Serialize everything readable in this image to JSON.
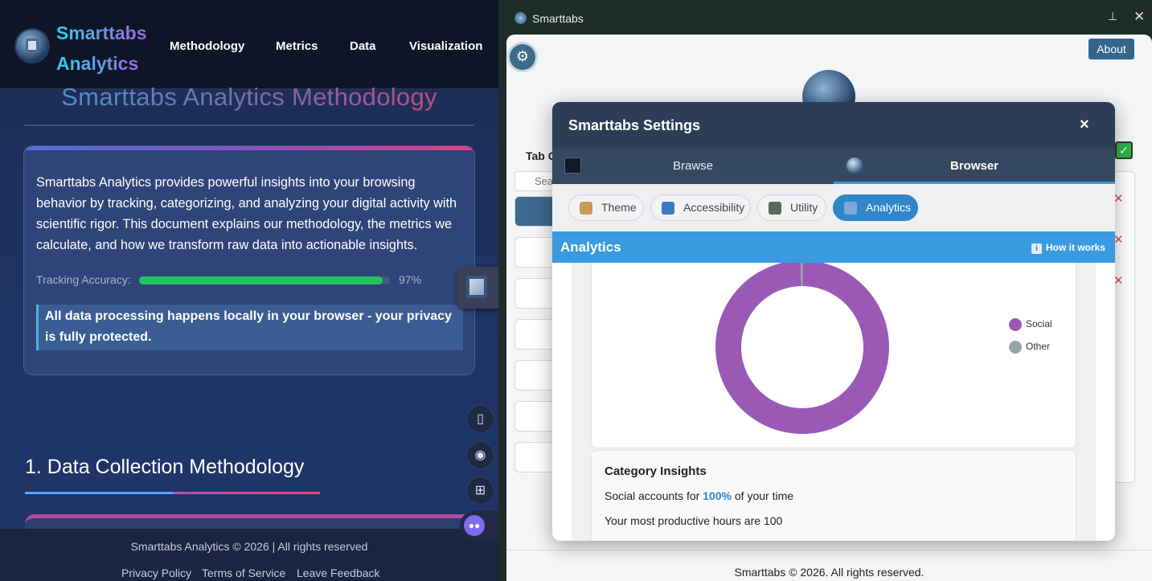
{
  "site": {
    "brand": "Smarttabs Analytics",
    "nav": [
      "Methodology",
      "Metrics",
      "Data",
      "Visualization"
    ],
    "page_title": "Smarttabs Analytics Methodology",
    "intro": "Smarttabs Analytics provides powerful insights into your browsing behavior by tracking, categorizing, and analyzing your digital activity with scientific rigor. This document explains our methodology, the metrics we calculate, and how we transform raw data into actionable insights.",
    "accuracy_label": "Tracking Accuracy:",
    "accuracy_value": "97%",
    "accuracy_fraction": 0.97,
    "privacy_note": "All data processing happens locally in your browser - your privacy is fully protected.",
    "section_title": "1. Data Collection Methodology",
    "footer_copy": "Smarttabs Analytics © 2026 | All rights reserved",
    "footer_links": [
      "Privacy Policy",
      "Terms of Service",
      "Leave Feedback"
    ],
    "fab_icons": [
      "book-icon",
      "broadcast-icon",
      "grid-icon",
      "bot-icon"
    ]
  },
  "window": {
    "title": "Smarttabs",
    "pin_glyph": "⊥",
    "close_glyph": "✕"
  },
  "app": {
    "about_label": "About",
    "tab_list_label": "Tab C",
    "search_placeholder": "Sea",
    "footer": "Smarttabs © 2026. All rights reserved."
  },
  "settings": {
    "title": "Smarttabs Settings",
    "close": "×",
    "tabs": [
      "Brawse",
      "Browser"
    ],
    "active_tab": "Browser",
    "subtabs": [
      "Theme",
      "Accessibility",
      "Utility",
      "Analytics"
    ],
    "active_subtab": "Analytics",
    "analytics_title": "Analytics",
    "how_it_works": "How it works",
    "insights_title": "Category Insights",
    "insight_prefix": "Social accounts for ",
    "insight_pct": "100%",
    "insight_suffix": " of your time",
    "insight_productive": "Your most productive hours are 100"
  },
  "chart_data": {
    "type": "pie",
    "categories": [
      "Social",
      "Other"
    ],
    "values": [
      99.6,
      0.4
    ],
    "colors": [
      "#9b59b6",
      "#95a5a6"
    ],
    "legend_placement": "right"
  }
}
